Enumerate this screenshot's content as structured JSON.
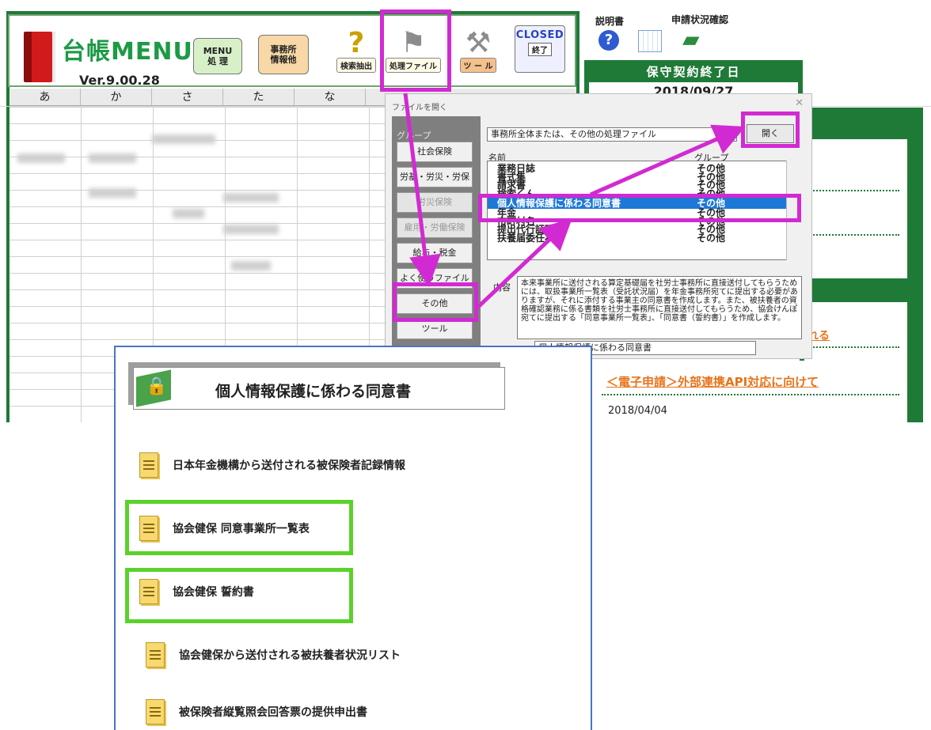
{
  "menu": {
    "logo_title": "台帳MENU",
    "version": "Ver.9.00.28",
    "buttons": {
      "menu_proc": "MENU\n処 理",
      "office": "事務所\n情報他",
      "search": "検索抽出",
      "proc_file": "処理ファイル",
      "tool": "ツ ー ル",
      "closed_title": "CLOSED",
      "closed_sub": "終了"
    },
    "kana_tabs": [
      "あ",
      "か",
      "さ",
      "た",
      "な"
    ]
  },
  "side": {
    "manual_label": "説明書",
    "status_label": "申請状況確認",
    "contract_title": "保守契約終了日",
    "contract_date": "2018/09/27",
    "news_link1": "れる",
    "news_link2": "＜電子申請＞外部連携API対応に向けて",
    "news_date": "2018/04/04"
  },
  "dialog": {
    "title": "ファイルを開く",
    "group_label": "グループ",
    "groups": [
      "社会保険",
      "労基・労災・労保",
      "労災保険",
      "雇用・労働保険",
      "給与・税金",
      "よく使うファイル",
      "その他",
      "ツール"
    ],
    "combo_value": "事務所全体または、その他の処理ファイル",
    "open_button": "開く",
    "col_name": "名前",
    "col_group": "グループ",
    "files": [
      {
        "name": "業務日誌",
        "group": "その他"
      },
      {
        "name": "書式集",
        "group": "その他"
      },
      {
        "name": "請求書",
        "group": "その他"
      },
      {
        "name": "検索くん",
        "group": "その他"
      },
      {
        "name": "個人情報保護に係わる同意書",
        "group": "その他"
      },
      {
        "name": "年金",
        "group": "その他"
      },
      {
        "name": "市町村名",
        "group": "その他"
      },
      {
        "name": "提出代行証明書",
        "group": "その他"
      },
      {
        "name": "扶養届委任状",
        "group": "その他"
      }
    ],
    "content_label": "内容",
    "content_text": "本来事業所に送付される算定基礎届を社労士事務所に直接送付してもらうためには、取扱事業所一覧表（受託状況届）を年金事務所宛てに提出する必要がありますが、それに添付する事業主の同意書を作成します。また、被扶養者の資格確認業務に係る書類を社労士事務所に直接送付してもらうため、協会けんぽ宛てに提出する「同意事業所一覧表」、「同意書（誓約書）」を作成します。",
    "filename": "個人情報保護に係わる同意書"
  },
  "consent": {
    "title": "個人情報保護に係わる同意書",
    "items": [
      "日本年金機構から送付される被保険者記録情報",
      "協会健保 同意事業所一覧表",
      "協会健保 誓約書",
      "協会健保から送付される被扶養者状況リスト",
      "被保険者縦覧照会回答票の提供申出書"
    ]
  },
  "colors": {
    "green": "#1f7a38",
    "pink": "#d22ad2",
    "highlight_green": "#5bd22a",
    "select_blue": "#1e78d7",
    "link_orange": "#e8731a"
  }
}
